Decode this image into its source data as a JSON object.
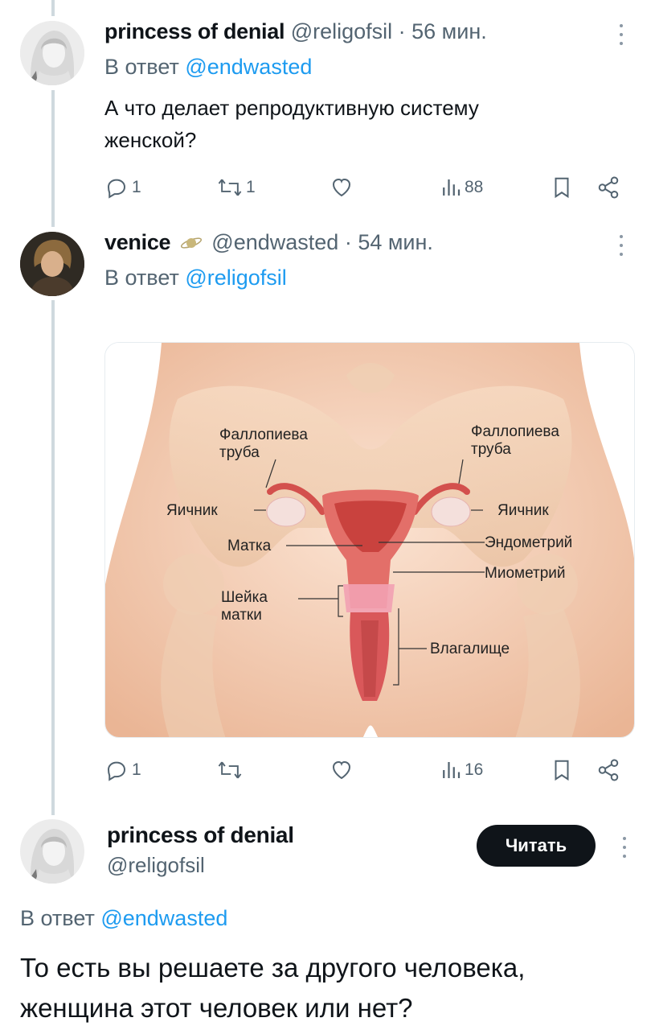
{
  "tweet1": {
    "name": "princess of denial",
    "handle": "@religofsil",
    "time": "· 56 мин.",
    "reply_prefix": "В ответ",
    "reply_handle": "@endwasted",
    "text_line1": "А что делает репродуктивную систему",
    "text_line2": "женской?",
    "replies": "1",
    "retweets": "1",
    "views": "88"
  },
  "tweet2": {
    "name": "venice",
    "handle": "@endwasted",
    "time": "· 54 мин.",
    "reply_prefix": "В ответ",
    "reply_handle": "@religofsil",
    "replies": "1",
    "views": "16",
    "image_labels": {
      "fallopian_left_1": "Фаллопиева",
      "fallopian_left_2": "труба",
      "fallopian_right_1": "Фаллопиева",
      "fallopian_right_2": "труба",
      "ovary_left": "Яичник",
      "ovary_right": "Яичник",
      "uterus": "Матка",
      "endometrium": "Эндометрий",
      "myometrium": "Миометрий",
      "cervix_1": "Шейка",
      "cervix_2": "матки",
      "vagina": "Влагалище"
    }
  },
  "tweet3": {
    "name": "princess of denial",
    "handle": "@religofsil",
    "follow_label": "Читать",
    "reply_prefix": "В ответ",
    "reply_handle": "@endwasted",
    "text_line1": "То есть вы решаете за другого человека,",
    "text_line2": "женщина этот человек или нет?"
  },
  "colors": {
    "accent": "#1d9bf0",
    "muted": "#536471",
    "line": "#cfd9de"
  }
}
